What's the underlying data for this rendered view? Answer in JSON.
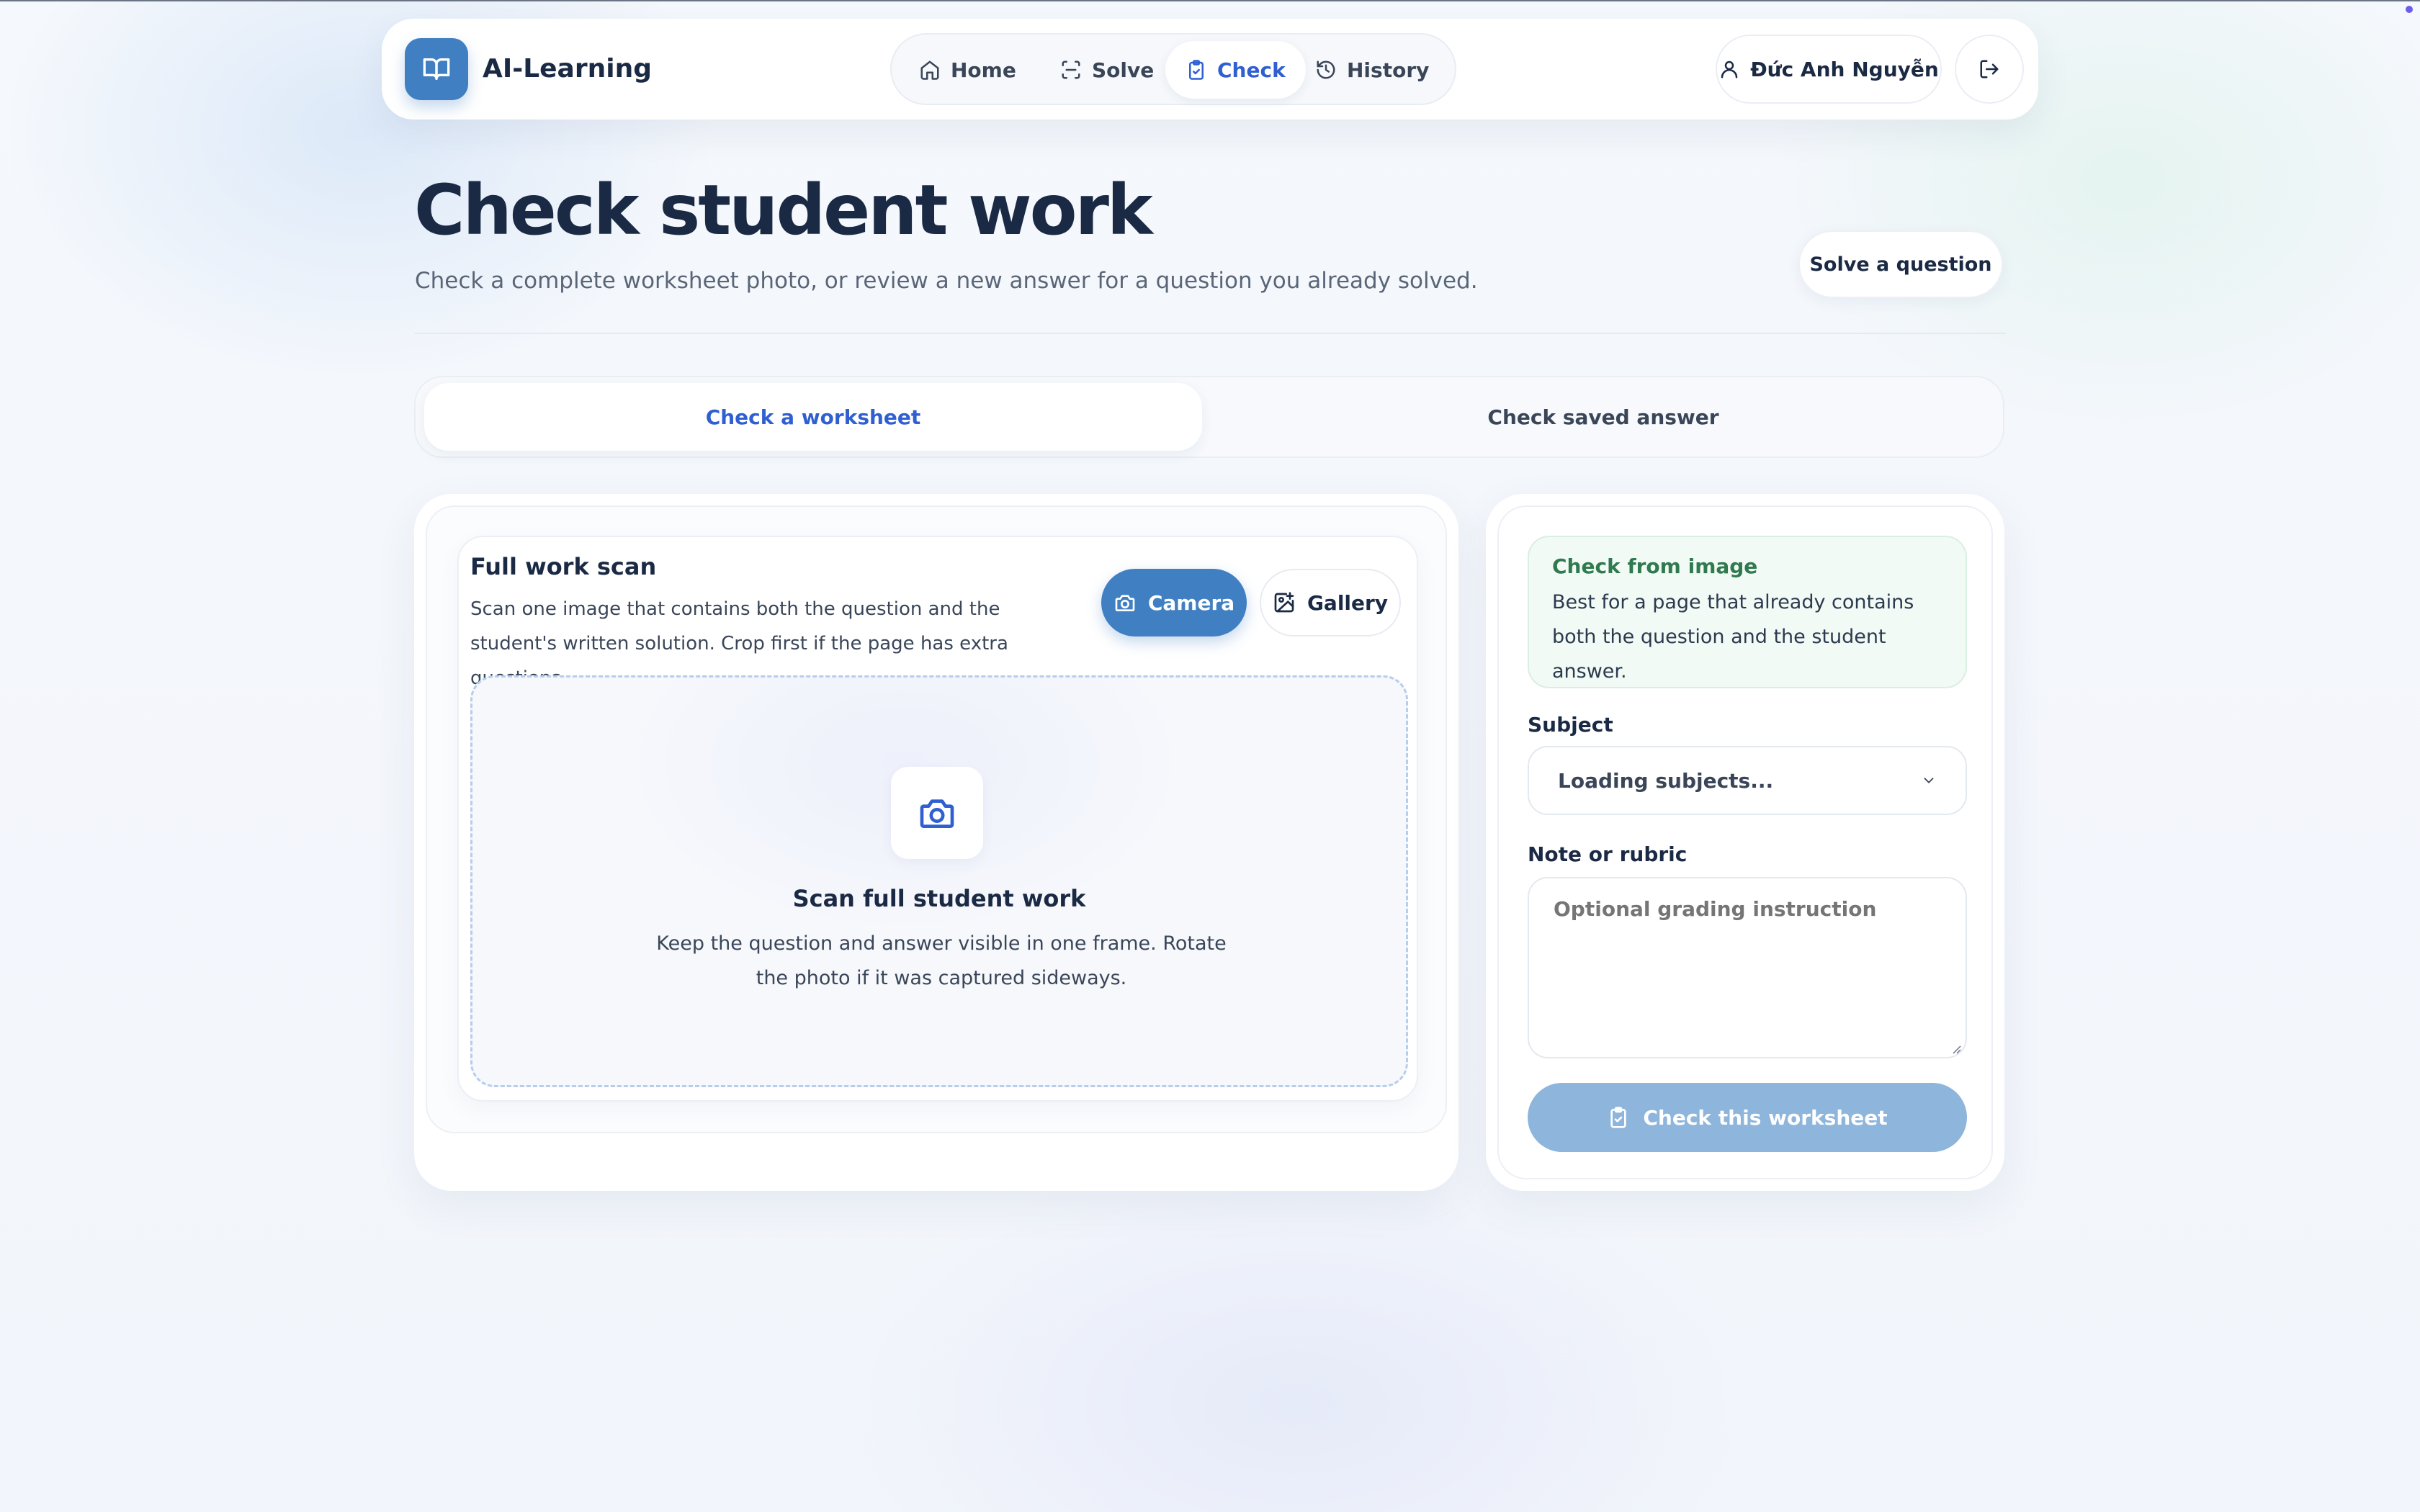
{
  "brand": {
    "name": "AI-Learning"
  },
  "nav": {
    "items": [
      {
        "label": "Home",
        "icon": "home-icon"
      },
      {
        "label": "Solve",
        "icon": "scan-icon"
      },
      {
        "label": "Check",
        "icon": "clipboard-check-icon",
        "active": true
      },
      {
        "label": "History",
        "icon": "history-icon"
      }
    ]
  },
  "user": {
    "name": "Đức Anh Nguyễn"
  },
  "page": {
    "title": "Check student work",
    "subtitle": "Check a complete worksheet photo, or review a new answer for a question you already solved.",
    "solve_button": "Solve a question"
  },
  "tabs": [
    {
      "label": "Check a worksheet",
      "active": true
    },
    {
      "label": "Check saved answer",
      "active": false
    }
  ],
  "scan": {
    "title": "Full work scan",
    "description": "Scan one image that contains both the question and the student's written solution. Crop first if the page has extra questions.",
    "camera_label": "Camera",
    "gallery_label": "Gallery",
    "dropzone_title": "Scan full student work",
    "dropzone_description": "Keep the question and answer visible in one frame. Rotate the photo if it was captured sideways."
  },
  "side": {
    "info_title": "Check from image",
    "info_description": "Best for a page that already contains both the question and the student answer.",
    "subject_label": "Subject",
    "subject_value": "Loading subjects...",
    "note_label": "Note or rubric",
    "note_placeholder": "Optional grading instruction",
    "submit_label": "Check this worksheet"
  },
  "colors": {
    "accent": "#2f5fd0",
    "primary_button": "#3f7fc2",
    "disabled_button": "#8eb5dc",
    "info_green": "#2f7a4e"
  }
}
